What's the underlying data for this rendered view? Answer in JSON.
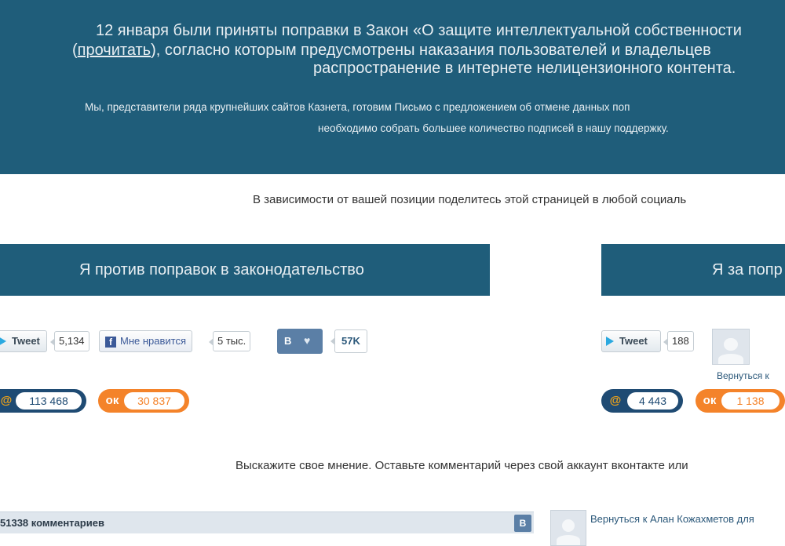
{
  "banner": {
    "line1": "12 января были приняты поправки в Закон «О защите интеллектуальной собственности",
    "line2_prefix": "(",
    "line2_link": "прочитать",
    "line2_suffix": "), согласно которым предусмотрены наказания пользователей и владельцев",
    "line3": "распространение в интернете нелицензионного контента.",
    "line4": "Мы, представители ряда крупнейших сайтов Казнета, готовим Письмо с предложением об отмене данных поп",
    "line5": "необходимо собрать большее количество подписей в нашу поддержку."
  },
  "share_note": "В зависимости от вашей позиции поделитесь этой страницей в любой социаль",
  "panels": {
    "against": {
      "title": "Я против поправок в законодательство",
      "tweet_label": "Tweet",
      "tweet_count": "5,134",
      "fb_label": "Мне нравится",
      "fb_count": "5 тыс.",
      "vk_label": "В",
      "vk_count": "57K",
      "mail_count": "113 468",
      "ok_count": "30 837"
    },
    "for": {
      "title": "Я за попр",
      "tweet_label": "Tweet",
      "tweet_count": "188",
      "back_link": "Вернуться к",
      "mail_count": "4 443",
      "ok_count": "1 138"
    }
  },
  "opinion": "Выскажите свое мнение. Оставьте комментарий через свой аккаунт вконтакте или",
  "comments": {
    "count_label": "51338 комментариев",
    "vk_label": "В",
    "back_link": "Вернуться к Алан Кожахметов для"
  },
  "colors": {
    "banner": "#1f5d7a",
    "vk": "#5b7fa6",
    "mailru": "#1f4b73",
    "odnoklassniki": "#f4832a"
  }
}
